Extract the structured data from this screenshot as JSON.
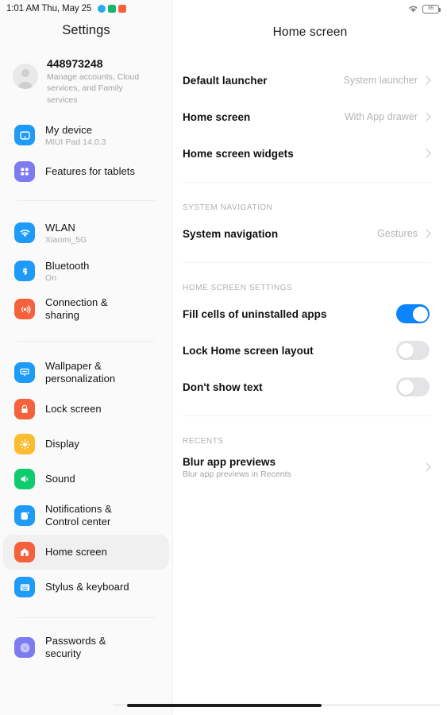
{
  "status_bar": {
    "time": "1:01 AM Thu, May 25",
    "notification_icons": [
      "telegram-icon",
      "green-app-icon",
      "orange-app-icon"
    ],
    "wifi": "wifi-icon",
    "battery_level": "85"
  },
  "sidebar": {
    "title": "Settings",
    "account": {
      "name": "448973248",
      "subtitle": "Manage accounts, Cloud services, and Family services",
      "avatar": "person-avatar-icon"
    },
    "groups": [
      {
        "items": [
          {
            "label": "My device",
            "sub": "MIUI Pad 14.0.3",
            "icon": "tablet-icon",
            "color": "#1d9bf6",
            "selected": false
          },
          {
            "label": "Features for tablets",
            "sub": "",
            "icon": "grid-apps-icon",
            "color": "#7e7bf0",
            "selected": false
          }
        ]
      },
      {
        "items": [
          {
            "label": "WLAN",
            "sub": "Xiaomi_5G",
            "icon": "wifi-icon",
            "color": "#1d9bf6",
            "selected": false
          },
          {
            "label": "Bluetooth",
            "sub": "On",
            "icon": "bluetooth-icon",
            "color": "#1d9bf6",
            "selected": false
          },
          {
            "label": "Connection & sharing",
            "sub": "",
            "icon": "connection-sharing-icon",
            "color": "#f4613c",
            "selected": false
          }
        ]
      },
      {
        "items": [
          {
            "label": "Wallpaper & personalization",
            "sub": "",
            "icon": "wallpaper-icon",
            "color": "#1d9bf6",
            "selected": false
          },
          {
            "label": "Lock screen",
            "sub": "",
            "icon": "lock-icon",
            "color": "#f4613c",
            "selected": false
          },
          {
            "label": "Display",
            "sub": "",
            "icon": "brightness-icon",
            "color": "#fbbc2e",
            "selected": false
          },
          {
            "label": "Sound",
            "sub": "",
            "icon": "speaker-icon",
            "color": "#0ecb6c",
            "selected": false
          },
          {
            "label": "Notifications & Control center",
            "sub": "",
            "icon": "notifications-icon",
            "color": "#1d9bf6",
            "selected": false
          },
          {
            "label": "Home screen",
            "sub": "",
            "icon": "home-icon",
            "color": "#f4613c",
            "selected": true
          },
          {
            "label": "Stylus & keyboard",
            "sub": "",
            "icon": "keyboard-icon",
            "color": "#1d9bf6",
            "selected": false
          }
        ]
      },
      {
        "items": [
          {
            "label": "Passwords & security",
            "sub": "",
            "icon": "fingerprint-shield-icon",
            "color": "#7e7bf0",
            "selected": false
          }
        ]
      }
    ]
  },
  "main": {
    "title": "Home screen",
    "rows": [
      {
        "label": "Default launcher",
        "value": "System launcher",
        "chevron": true
      },
      {
        "label": "Home screen",
        "value": "With App drawer",
        "chevron": true
      },
      {
        "label": "Home screen widgets",
        "value": "",
        "chevron": true
      }
    ],
    "system_navigation": {
      "header": "System navigation",
      "rows": [
        {
          "label": "System navigation",
          "value": "Gestures",
          "chevron": true
        }
      ]
    },
    "home_screen_settings": {
      "header": "Home screen settings",
      "toggles": [
        {
          "label": "Fill cells of uninstalled apps",
          "on": true
        },
        {
          "label": "Lock Home screen layout",
          "on": false
        },
        {
          "label": "Don't show text",
          "on": false
        }
      ]
    },
    "recents": {
      "header": "Recents",
      "rows": [
        {
          "label": "Blur app previews",
          "sub": "Blur app previews in Recents",
          "chevron": true
        }
      ]
    }
  },
  "colors": {
    "accent_blue": "#0b84fe",
    "toggle_off": "#e4e4e6",
    "sidebar_bg": "#fafafa",
    "selected_bg": "#f0f0f0"
  }
}
